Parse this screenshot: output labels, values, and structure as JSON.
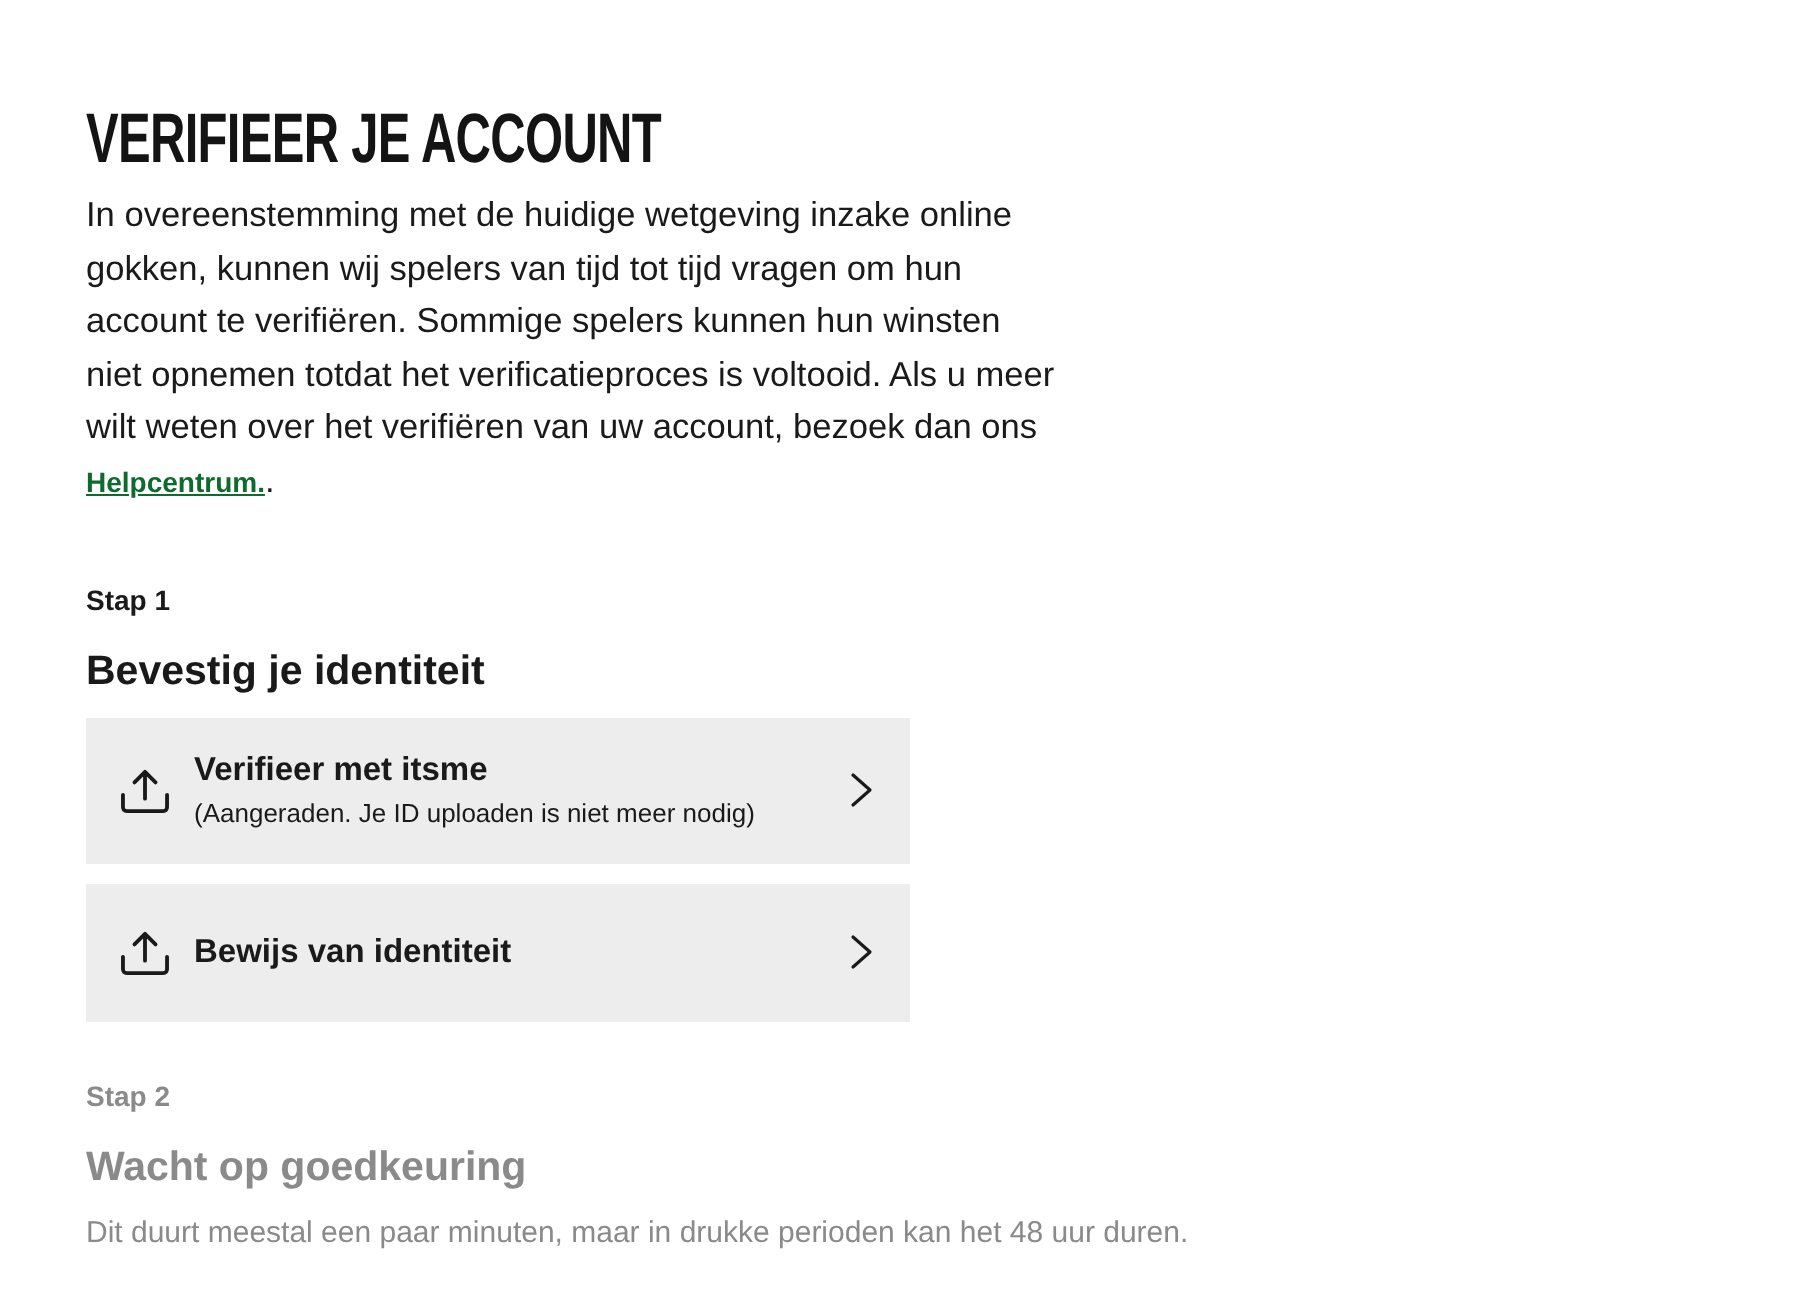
{
  "page": {
    "title": "VERIFIEER JE ACCOUNT",
    "intro": {
      "text": "In overeenstemming met de huidige wetgeving inzake online gokken, kunnen wij spelers van tijd tot tijd vragen om hun account te verifiëren. Sommige spelers kunnen hun winsten niet opnemen totdat het verificatieproces is voltooid. Als u meer wilt weten over het verifiëren van uw account, bezoek dan ons ",
      "link": "Helpcentrum.",
      "after": "."
    }
  },
  "steps": [
    {
      "label": "Stap 1",
      "heading": "Bevestig je identiteit",
      "active": true,
      "options": [
        {
          "title": "Verifieer met itsme",
          "subtitle": "(Aangeraden. Je ID uploaden is niet meer nodig)"
        },
        {
          "title": "Bewijs van identiteit"
        }
      ]
    },
    {
      "label": "Stap 2",
      "heading": "Wacht op goedkeuring",
      "active": false,
      "description": "Dit duurt meestal een paar minuten, maar in drukke perioden kan het 48 uur duren."
    }
  ]
}
